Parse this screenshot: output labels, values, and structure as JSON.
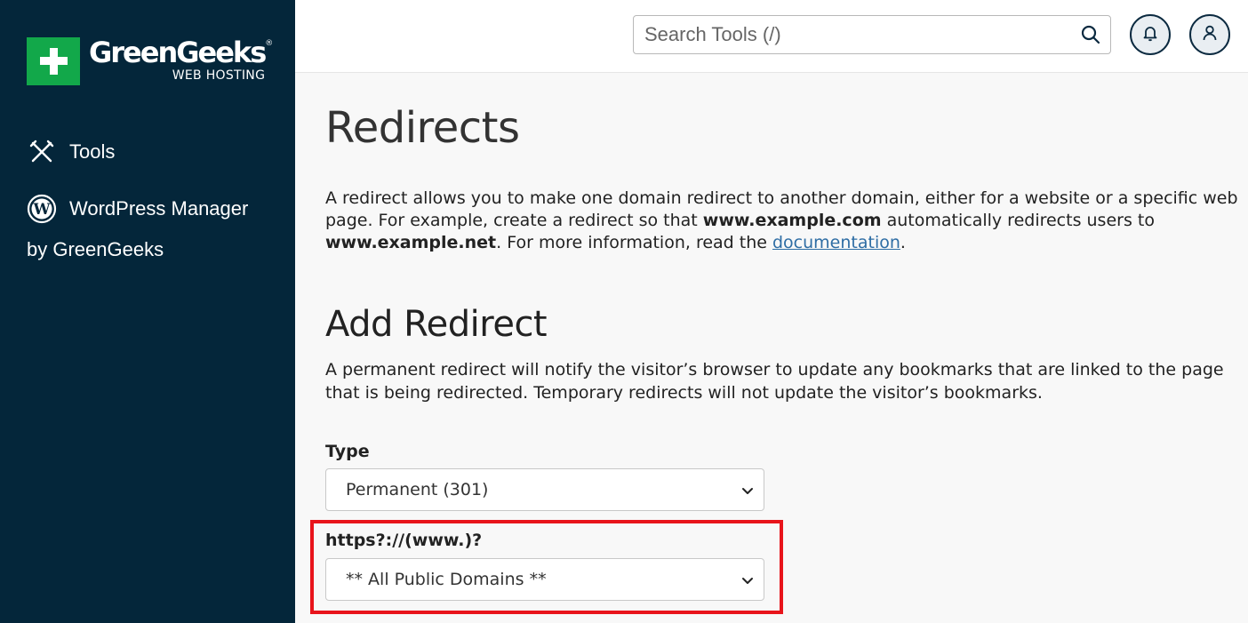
{
  "sidebar": {
    "logo": {
      "name": "GreenGeeks",
      "registered": "®",
      "sub": "WEB HOSTING"
    },
    "items": [
      {
        "label": "Tools",
        "icon": "tools-icon"
      },
      {
        "label": "WordPress Manager",
        "icon": "wordpress-icon"
      }
    ],
    "sub_label": "by GreenGeeks"
  },
  "topbar": {
    "search_placeholder": "Search Tools (/)",
    "icons": [
      "search-icon",
      "bell-icon",
      "user-icon"
    ]
  },
  "main": {
    "title": "Redirects",
    "intro": {
      "part1": "A redirect allows you to make one domain redirect to another domain, either for a website or a specific web page. For example, create a redirect so that ",
      "bold1": "www.example.com",
      "part2": " automatically redirects users to ",
      "bold2": "www.example.net",
      "part3": ". For more information, read the ",
      "link": "documentation",
      "part4": "."
    },
    "section_title": "Add Redirect",
    "section_desc": "A permanent redirect will notify the visitor’s browser to update any bookmarks that are linked to the page that is being redirected. Temporary redirects will not update the visitor’s bookmarks.",
    "type_label": "Type",
    "type_value": "Permanent (301)",
    "domain_label": "https?://(www.)?",
    "domain_value": "** All Public Domains **"
  },
  "colors": {
    "sidebar_bg": "#04263a",
    "brand_green": "#12a84a",
    "link": "#2e6da4",
    "highlight": "#e8141b"
  }
}
